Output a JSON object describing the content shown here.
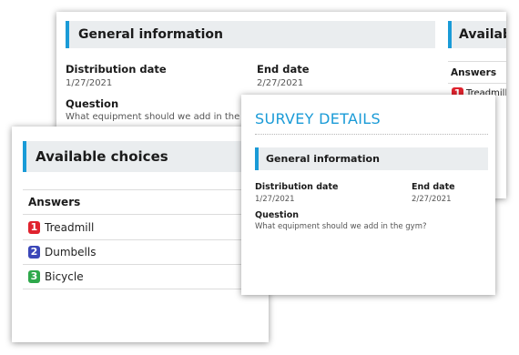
{
  "back_card": {
    "section_title": "General information",
    "distribution_date_label": "Distribution date",
    "distribution_date_value": "1/27/2021",
    "end_date_label": "End date",
    "end_date_value": "2/27/2021",
    "question_label": "Question",
    "question_value": "What equipment should we add in the gym?",
    "side_section_title": "Available choices",
    "side_answers_label": "Answers",
    "side_answers": [
      {
        "number": "1",
        "label": "Treadmill",
        "color": "#e0232e"
      }
    ]
  },
  "choices_card": {
    "title": "Available choices",
    "answers_label": "Answers",
    "answers": [
      {
        "number": "1",
        "label": "Treadmill",
        "color": "#e0232e"
      },
      {
        "number": "2",
        "label": "Dumbells",
        "color": "#3b47b8"
      },
      {
        "number": "3",
        "label": "Bicycle",
        "color": "#2ea84b"
      }
    ]
  },
  "survey_card": {
    "title": "SURVEY DETAILS",
    "section_title": "General information",
    "distribution_date_label": "Distribution date",
    "distribution_date_value": "1/27/2021",
    "end_date_label": "End date",
    "end_date_value": "2/27/2021",
    "question_label": "Question",
    "question_value": "What equipment should we add in the gym?"
  },
  "colors": {
    "accent": "#1a9bd7",
    "section_bg": "#eaedef"
  }
}
